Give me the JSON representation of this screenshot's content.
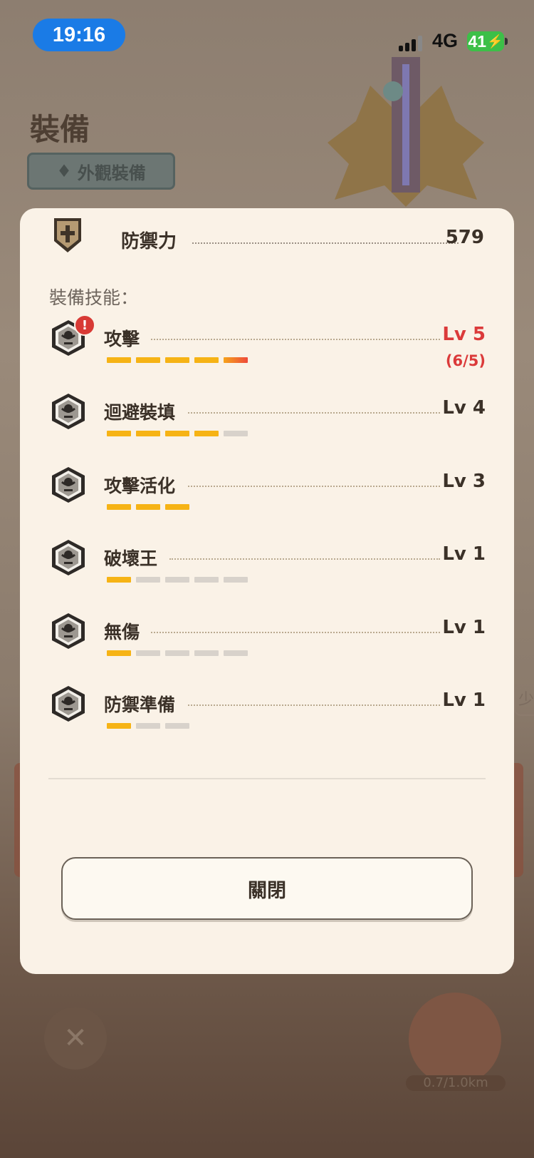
{
  "status_bar": {
    "time": "19:16",
    "network": "4G",
    "battery": "41"
  },
  "background": {
    "title": "裝備",
    "appearance_button": "外觀裝備",
    "distance": "0.7/1.0km",
    "side_label": "少"
  },
  "modal": {
    "defense": {
      "label": "防禦力",
      "value": "579"
    },
    "skills_heading": "裝備技能：",
    "skills": [
      {
        "name": "攻擊",
        "level": "Lv 5",
        "overflow": "(6/5)",
        "filled": 5,
        "total": 5,
        "warning": true
      },
      {
        "name": "迴避裝填",
        "level": "Lv 4",
        "filled": 4,
        "total": 5
      },
      {
        "name": "攻擊活化",
        "level": "Lv 3",
        "filled": 3,
        "total": 3
      },
      {
        "name": "破壞王",
        "level": "Lv 1",
        "filled": 1,
        "total": 5
      },
      {
        "name": "無傷",
        "level": "Lv 1",
        "filled": 1,
        "total": 5
      },
      {
        "name": "防禦準備",
        "level": "Lv 1",
        "filled": 1,
        "total": 3
      }
    ],
    "close_label": "關閉"
  },
  "colors": {
    "accent_gold": "#f6b315",
    "warning_red": "#db3a3a",
    "panel_bg": "#faf2e7",
    "time_pill": "#1a7be6",
    "battery_green": "#3dbf48"
  }
}
